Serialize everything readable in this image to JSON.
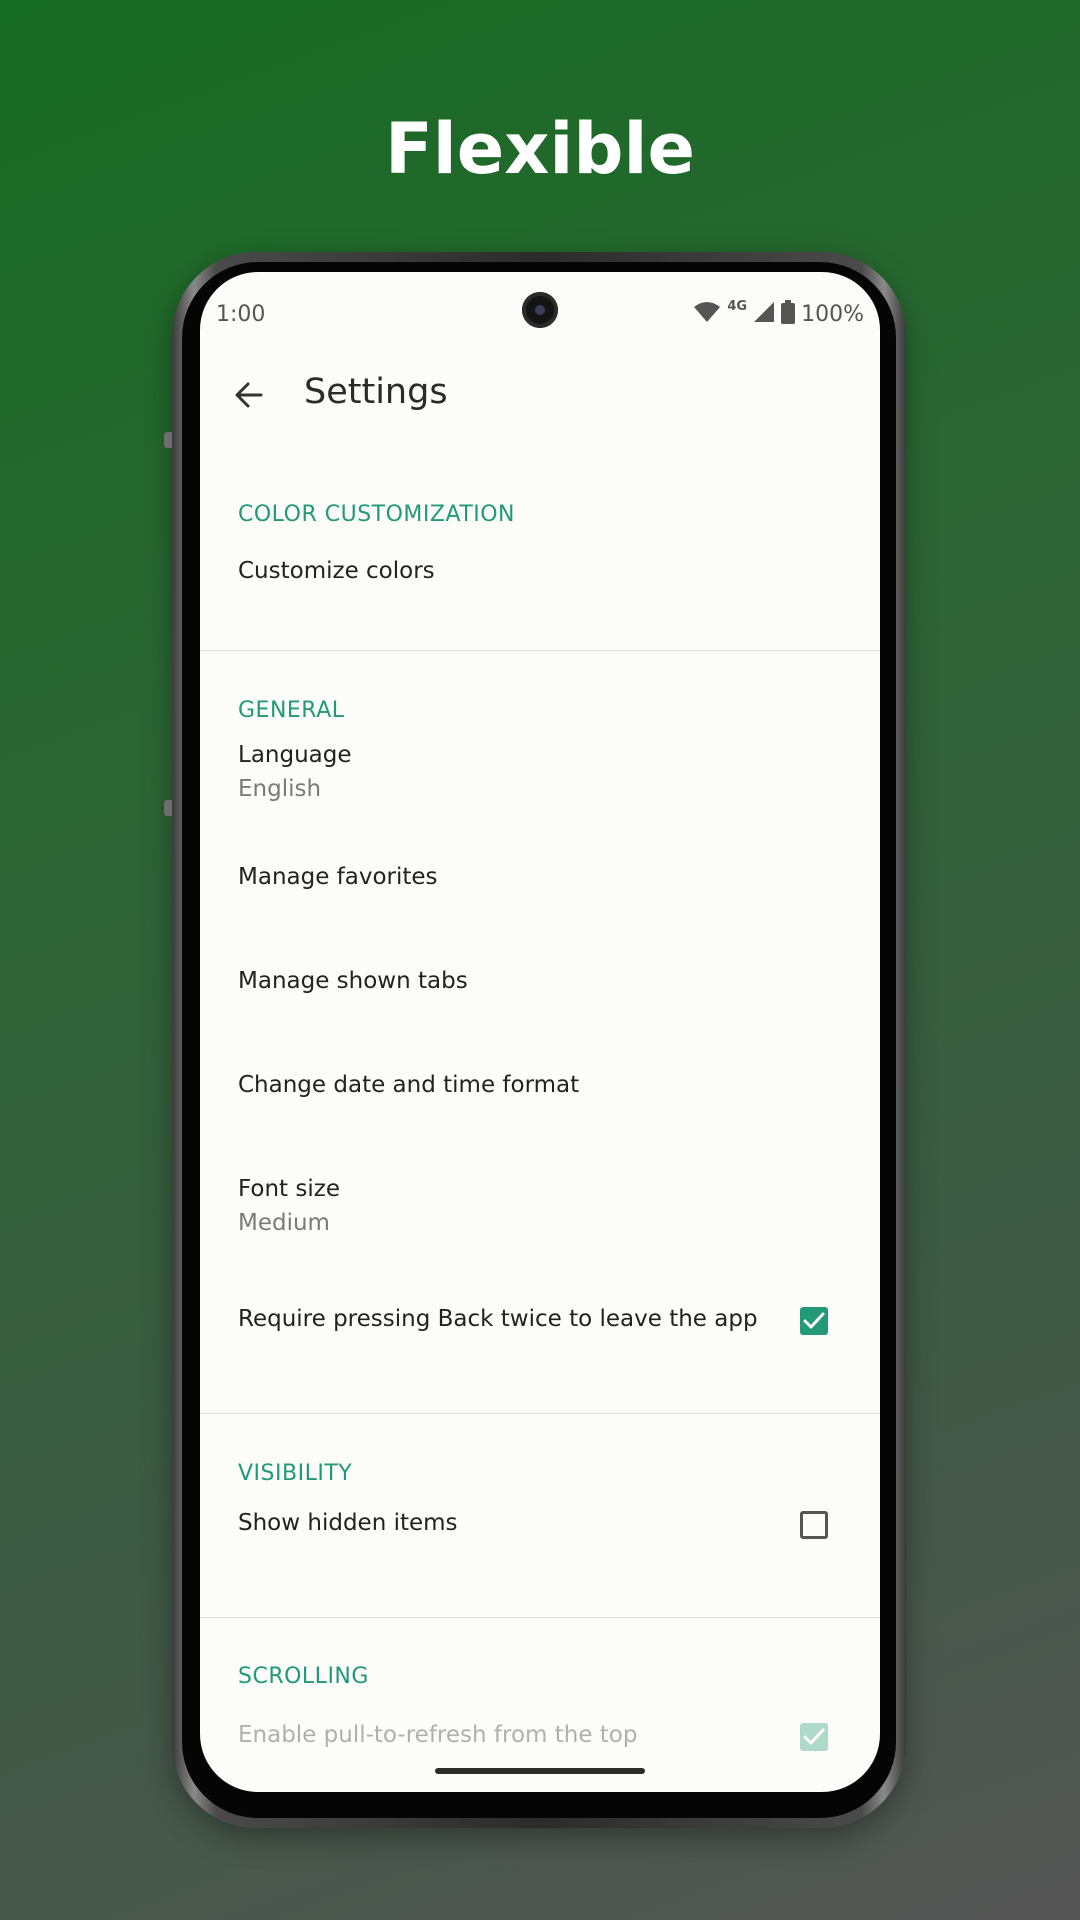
{
  "headline": "Flexible",
  "status_bar": {
    "time": "1:00",
    "network": "4G",
    "battery": "100%"
  },
  "appbar": {
    "title": "Settings"
  },
  "sections": {
    "color": {
      "header": "COLOR CUSTOMIZATION",
      "items": [
        "Customize colors"
      ]
    },
    "general": {
      "header": "GENERAL",
      "language": {
        "title": "Language",
        "value": "English"
      },
      "manage_favorites": "Manage favorites",
      "manage_tabs": "Manage shown tabs",
      "date_time": "Change date and time format",
      "font_size": {
        "title": "Font size",
        "value": "Medium"
      },
      "back_twice": {
        "title": "Require pressing Back twice to leave the app",
        "checked": true
      }
    },
    "visibility": {
      "header": "VISIBILITY",
      "show_hidden": {
        "title": "Show hidden items",
        "checked": false
      }
    },
    "scrolling": {
      "header": "SCROLLING",
      "pull_refresh": {
        "title": "Enable pull-to-refresh from the top",
        "checked": true
      }
    }
  },
  "colors": {
    "accent": "#229977",
    "screen_bg": "#fcfdf9"
  },
  "icons": {
    "back": "arrow-left-icon",
    "wifi": "wifi-icon",
    "signal": "signal-icon",
    "battery": "battery-icon",
    "check": "check-icon"
  }
}
